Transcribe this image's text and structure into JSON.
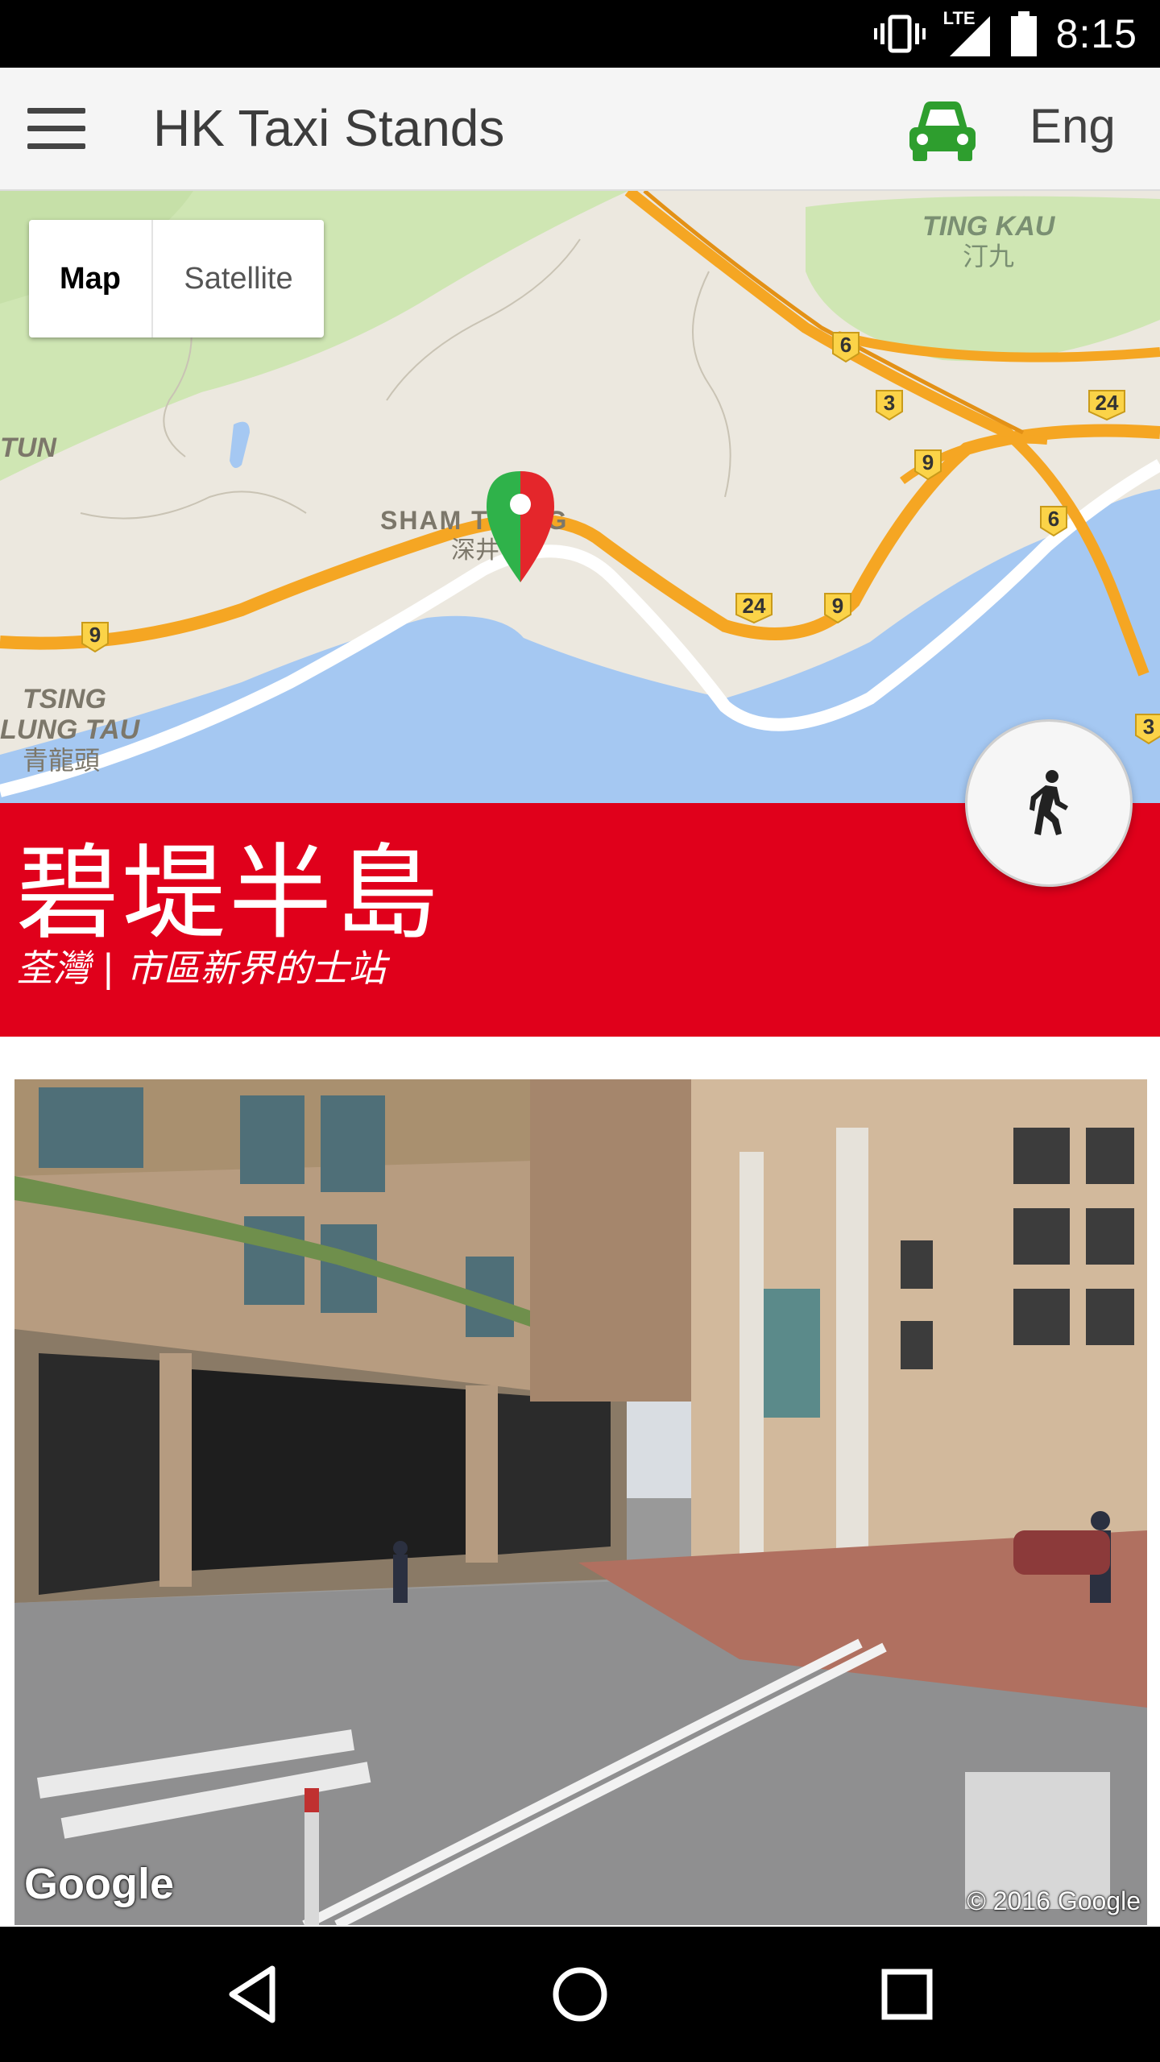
{
  "status_bar": {
    "time": "8:15",
    "network_label": "LTE",
    "icons": [
      "vibrate-icon",
      "signal-icon",
      "battery-icon"
    ]
  },
  "app_bar": {
    "title": "HK Taxi Stands",
    "language_button": "Eng",
    "icons": [
      "menu-icon",
      "taxi-icon"
    ],
    "taxi_color": "#2e9e2e"
  },
  "map": {
    "type_options": [
      "Map",
      "Satellite"
    ],
    "selected_type": "Map",
    "labels": {
      "ting_kau_en": "TING KAU",
      "ting_kau_zh": "汀九",
      "sham_tseng": "SHAM TSENG",
      "sham_tseng_zh": "深井",
      "tsing_lung_tau_1": "TSING",
      "tsing_lung_tau_2": "LUNG TAU",
      "tsing_lung_tau_zh": "青龍頭",
      "tun": "TUN"
    },
    "route_shields": [
      "6",
      "3",
      "24",
      "9",
      "6",
      "24",
      "9",
      "9",
      "3"
    ],
    "marker_colors": [
      "#2fb24a",
      "#e4262b"
    ]
  },
  "stand": {
    "name": "碧堤半島",
    "subtitle": "荃灣 | 市區新界的士站",
    "band_color": "#e0001b"
  },
  "walk_button": {
    "icon": "walking-person-icon"
  },
  "street_view": {
    "logo": "Google",
    "copyright": "© 2016 Google"
  },
  "nav_bar": {
    "icons": [
      "back-icon",
      "home-icon",
      "recents-icon"
    ]
  }
}
